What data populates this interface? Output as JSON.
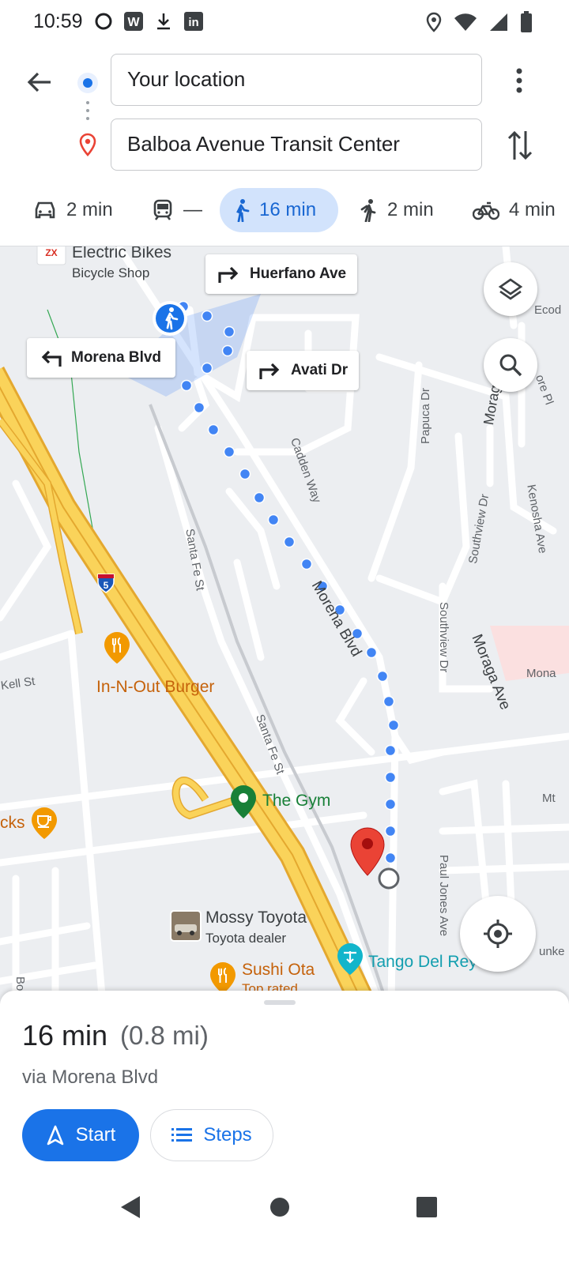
{
  "status_bar": {
    "time": "10:59",
    "left_icons": [
      "sync-icon",
      "w-app-icon",
      "download-icon",
      "linkedin-icon"
    ],
    "right_icons": [
      "location-icon",
      "wifi-icon",
      "signal-icon",
      "battery-icon"
    ]
  },
  "header": {
    "origin": "Your location",
    "destination": "Balboa Avenue Transit Center"
  },
  "modes": [
    {
      "icon": "car-icon",
      "label": "2 min",
      "active": false
    },
    {
      "icon": "transit-icon",
      "label": "—",
      "active": false
    },
    {
      "icon": "walk-icon",
      "label": "16 min",
      "active": true
    },
    {
      "icon": "rideshare-icon",
      "label": "2 min",
      "active": false
    },
    {
      "icon": "bike-icon",
      "label": "4 min",
      "active": false
    }
  ],
  "map": {
    "turns": [
      {
        "direction": "right",
        "label": "Huerfano Ave"
      },
      {
        "direction": "left",
        "label": "Morena Blvd"
      },
      {
        "direction": "right",
        "label": "Avati Dr"
      }
    ],
    "pois": {
      "electric_bikes": {
        "name": "Electric Bikes",
        "sub": "Bicycle Shop"
      },
      "in_n_out": {
        "name": "In-N-Out Burger"
      },
      "the_gym": {
        "name": "The Gym"
      },
      "mossy": {
        "name": "Mossy Toyota",
        "sub": "Toyota dealer"
      },
      "sushi": {
        "name": "Sushi Ota",
        "sub": "Top rated"
      },
      "tango": {
        "name": "Tango Del Rey"
      },
      "cks": {
        "name": "cks"
      }
    },
    "streets": {
      "morena": "Morena Blvd",
      "cadden": "Cadden Way",
      "papuca": "Papuca Dr",
      "southview1": "Southview Dr",
      "southview2": "Southview Dr",
      "kenosha": "Kenosha Ave",
      "moraga": "Moraga Ave",
      "moraga_top": "Moraga",
      "santafe1": "Santa Fe St",
      "santafe2": "Santa Fe St",
      "paul_jones": "Paul Jones Ave",
      "kell": "Kell St",
      "eco": "Ecod",
      "ore": "ore Pl",
      "mona": "Mona",
      "mt": "Mt",
      "unke": "unke",
      "bo": "Bo"
    },
    "highway_shield": "5",
    "colors": {
      "route": "#4285f4",
      "highway": "#f6c244",
      "pin": "#ea4335",
      "poi_food": "#e8710a",
      "poi_gym": "#188038",
      "poi_tango": "#12b5cb"
    }
  },
  "sheet": {
    "duration": "16 min",
    "distance": "(0.8 mi)",
    "via": "via Morena Blvd",
    "start_label": "Start",
    "steps_label": "Steps"
  },
  "navbar": {
    "icons": [
      "back-nav-icon",
      "home-nav-icon",
      "recents-nav-icon"
    ]
  }
}
